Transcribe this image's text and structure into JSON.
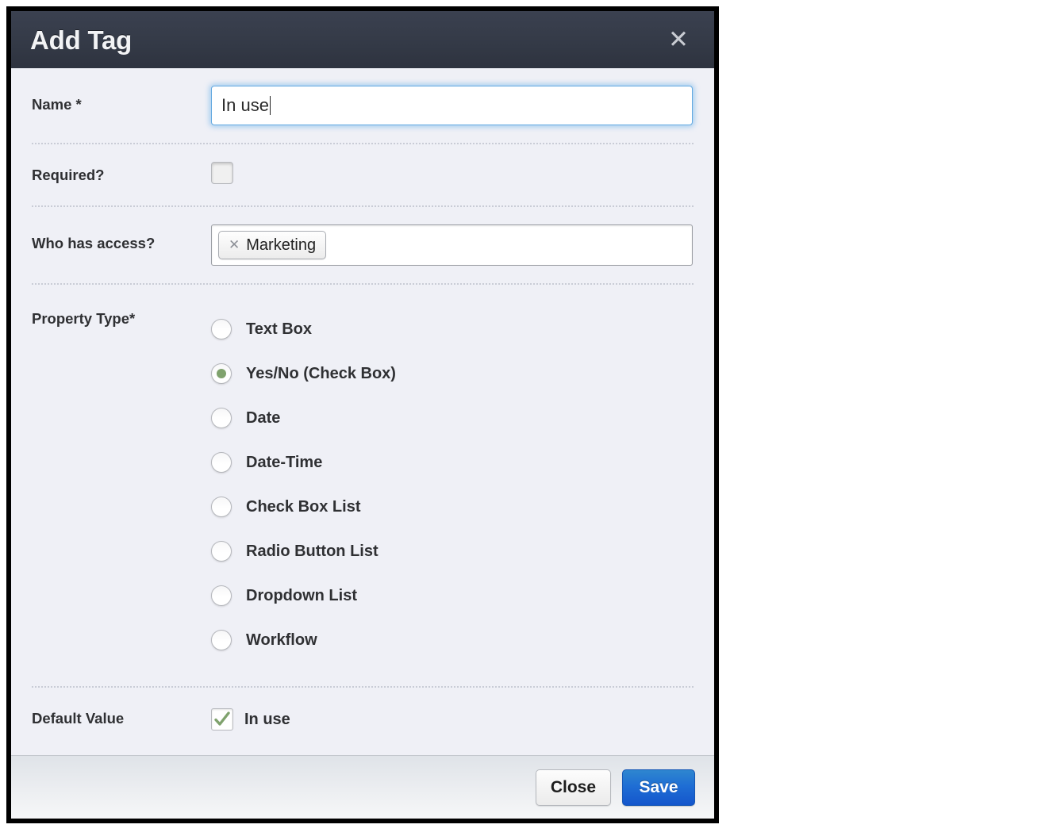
{
  "modal": {
    "title": "Add Tag",
    "close_icon": "close-icon",
    "close_glyph": "✕"
  },
  "form": {
    "name": {
      "label": "Name *",
      "value": "In use",
      "placeholder": ""
    },
    "required": {
      "label": "Required?",
      "checked": false
    },
    "access": {
      "label": "Who has access?",
      "tokens": [
        {
          "label": "Marketing",
          "remove_glyph": "✕"
        }
      ]
    },
    "property_type": {
      "label": "Property Type*",
      "selected": "Yes/No (Check Box)",
      "options": [
        {
          "label": "Text Box",
          "selected": false
        },
        {
          "label": "Yes/No (Check Box)",
          "selected": true
        },
        {
          "label": "Date",
          "selected": false
        },
        {
          "label": "Date-Time",
          "selected": false
        },
        {
          "label": "Check Box List",
          "selected": false
        },
        {
          "label": "Radio Button List",
          "selected": false
        },
        {
          "label": "Dropdown List",
          "selected": false
        },
        {
          "label": "Workflow",
          "selected": false
        }
      ]
    },
    "default_value": {
      "label": "Default Value",
      "checkbox_label": "In use",
      "checked": true
    }
  },
  "footer": {
    "close_label": "Close",
    "save_label": "Save"
  },
  "colors": {
    "header_bg": "#343a47",
    "body_bg": "#eff0f6",
    "accent_green": "#7fa26d",
    "save_blue": "#1f6ed4",
    "focus_blue": "#62a8e0"
  }
}
